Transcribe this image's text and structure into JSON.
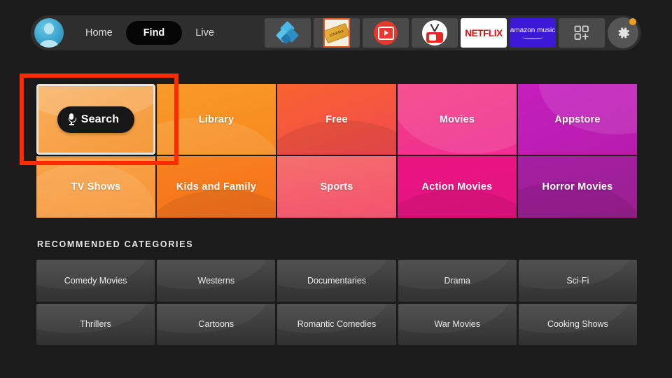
{
  "nav": {
    "avatar_name": "profile-avatar",
    "items": [
      {
        "label": "Home",
        "active": false
      },
      {
        "label": "Find",
        "active": true
      },
      {
        "label": "Live",
        "active": false
      }
    ]
  },
  "app_shortcuts": [
    {
      "name": "kodi",
      "label": ""
    },
    {
      "name": "cinema-hd",
      "label": "CINEMA"
    },
    {
      "name": "red-tv-app",
      "label": ""
    },
    {
      "name": "mobdro-tv-app",
      "label": ""
    },
    {
      "name": "netflix",
      "label": "NETFLIX"
    },
    {
      "name": "amazon-music",
      "label": "amazon music"
    },
    {
      "name": "all-apps-grid",
      "label": ""
    },
    {
      "name": "settings-gear",
      "label": ""
    }
  ],
  "search_tile": {
    "label": "Search",
    "icon": "microphone-icon",
    "highlighted": true
  },
  "category_tiles": [
    {
      "label": "Library",
      "color": "#f7931e"
    },
    {
      "label": "Free",
      "color": "#f4533f"
    },
    {
      "label": "Movies",
      "color": "#ee3b8c"
    },
    {
      "label": "Appstore",
      "color": "#c021b5"
    },
    {
      "label": "TV Shows",
      "color": "#f79a3e"
    },
    {
      "label": "Kids and Family",
      "color": "#f4781c"
    },
    {
      "label": "Sports",
      "color": "#f2564f"
    },
    {
      "label": "Action Movies",
      "color": "#e91a82"
    },
    {
      "label": "Horror Movies",
      "color": "#a3219e"
    }
  ],
  "recommended": {
    "heading": "RECOMMENDED CATEGORIES",
    "tiles": [
      {
        "label": "Comedy Movies"
      },
      {
        "label": "Westerns"
      },
      {
        "label": "Documentaries"
      },
      {
        "label": "Drama"
      },
      {
        "label": "Sci-Fi"
      },
      {
        "label": "Thrillers"
      },
      {
        "label": "Cartoons"
      },
      {
        "label": "Romantic Comedies"
      },
      {
        "label": "War Movies"
      },
      {
        "label": "Cooking Shows"
      }
    ]
  },
  "colors": {
    "background": "#1b1b1b",
    "topbar": "#2e2e2e",
    "highlight_box": "#ff2b00",
    "accent_orange": "#f59e1b",
    "netflix_red": "#e50914",
    "amazon_blue": "#3b18d6"
  }
}
